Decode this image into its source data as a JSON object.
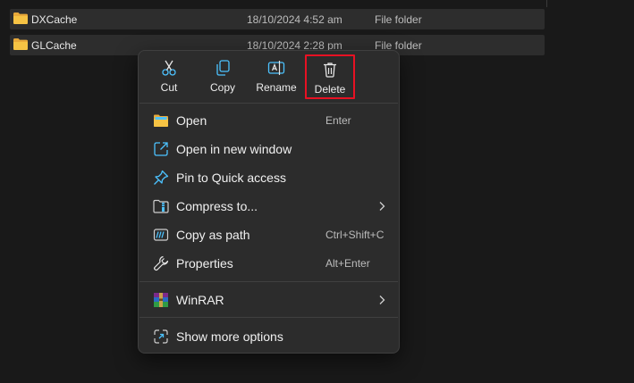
{
  "files": [
    {
      "name": "DXCache",
      "date": "18/10/2024 4:52 am",
      "type": "File folder"
    },
    {
      "name": "GLCache",
      "date": "18/10/2024 2:28 pm",
      "type": "File folder"
    }
  ],
  "context_menu": {
    "quick_actions": [
      {
        "label": "Cut",
        "icon": "cut-icon"
      },
      {
        "label": "Copy",
        "icon": "copy-icon"
      },
      {
        "label": "Rename",
        "icon": "rename-icon"
      },
      {
        "label": "Delete",
        "icon": "delete-icon",
        "highlighted": true
      }
    ],
    "items": [
      {
        "label": "Open",
        "shortcut": "Enter",
        "icon": "folder-open-icon"
      },
      {
        "label": "Open in new window",
        "shortcut": "",
        "icon": "open-new-window-icon"
      },
      {
        "label": "Pin to Quick access",
        "shortcut": "",
        "icon": "pin-icon"
      },
      {
        "label": "Compress to...",
        "shortcut": "",
        "icon": "compress-icon",
        "submenu": true
      },
      {
        "label": "Copy as path",
        "shortcut": "Ctrl+Shift+C",
        "icon": "copy-path-icon"
      },
      {
        "label": "Properties",
        "shortcut": "Alt+Enter",
        "icon": "wrench-icon"
      },
      {
        "label": "WinRAR",
        "shortcut": "",
        "icon": "winrar-icon",
        "submenu": true
      },
      {
        "label": "Show more options",
        "shortcut": "",
        "icon": "show-more-options-icon"
      }
    ]
  },
  "colors": {
    "background": "#191919",
    "menu_background": "#2c2c2c",
    "highlight_border": "#e81123",
    "folder_yellow": "#f6c344",
    "accent_blue": "#4cc2ff"
  }
}
